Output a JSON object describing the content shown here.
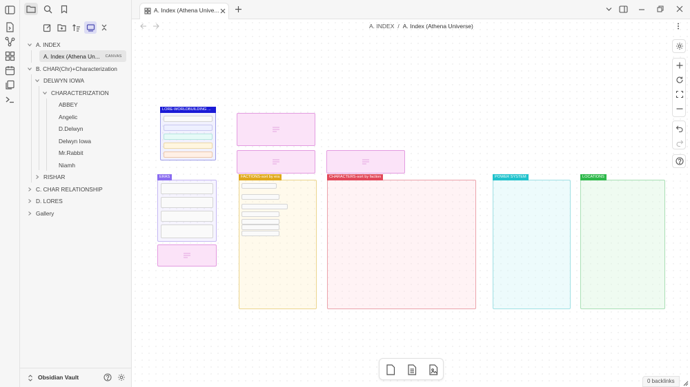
{
  "tab": {
    "title": "A. Index (Athena Unive..."
  },
  "breadcrumb": {
    "parent": "A. INDEX",
    "separator": "/",
    "current": "A. Index (Athena Universe)"
  },
  "sidebar": {
    "vault_name": "Obsidian Vault",
    "tree": [
      {
        "label": "A. INDEX",
        "expanded": true
      },
      {
        "label": "A. Index (Athena Un...",
        "badge": "CANVAS",
        "selected": true
      },
      {
        "label": "B. CHAR(Chr)+Characterization",
        "expanded": true
      },
      {
        "label": "DELWYN IOWA",
        "expanded": true
      },
      {
        "label": "CHARACTERIZATION",
        "expanded": true
      },
      {
        "label": "ABBEY"
      },
      {
        "label": "Angelic"
      },
      {
        "label": "D.Delwyn"
      },
      {
        "label": "Delwyn Iowa"
      },
      {
        "label": "Mr.Rabbit"
      },
      {
        "label": "Niamh"
      },
      {
        "label": "RISHAR",
        "expanded": false
      },
      {
        "label": "C. CHAR RELATIONSHIP",
        "expanded": false
      },
      {
        "label": "D. LORES",
        "expanded": false
      },
      {
        "label": "Gallery",
        "expanded": false
      }
    ]
  },
  "canvas": {
    "groups": {
      "lore": {
        "label": "LORE-WORLDBUILDING ...",
        "color": "#1a1ad6"
      },
      "eras": {
        "label": "ERAS",
        "color": "#8a6cf0"
      },
      "factions": {
        "label": "FACTIONS-sort by era",
        "color": "#e0a81c"
      },
      "characters": {
        "label": "CHARACTERS-sort by faction",
        "color": "#e2485a"
      },
      "power": {
        "label": "POWER SYSTEM",
        "color": "#1fc2cc"
      },
      "locations": {
        "label": "LOCATIONS",
        "color": "#2eb84a"
      }
    }
  },
  "status_bar": {
    "backlinks": "0 backlinks"
  },
  "icons": [
    "sidebar-toggle-icon",
    "folder-icon",
    "search-icon",
    "bookmark-icon",
    "new-note-icon",
    "new-folder-icon",
    "sort-icon",
    "auto-reveal-icon",
    "collapse-all-icon",
    "chevron-down-icon",
    "chevron-right-icon",
    "help-icon",
    "settings-icon",
    "plus-icon",
    "reset-icon",
    "fit-icon",
    "minus-icon",
    "undo-icon",
    "redo-icon",
    "card-icon",
    "note-icon",
    "media-icon"
  ]
}
